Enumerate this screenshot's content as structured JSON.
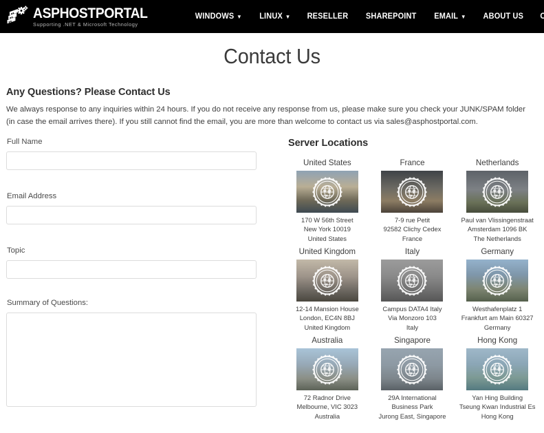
{
  "header": {
    "logo": {
      "icon": "server-rack-gear-icon",
      "title": "ASPHOSTPORTAL",
      "tagline": "Supporting .NET & Microsoft Technology"
    },
    "nav_items": [
      {
        "label": "WINDOWS",
        "has_caret": true
      },
      {
        "label": "LINUX",
        "has_caret": true
      },
      {
        "label": "RESELLER",
        "has_caret": false
      },
      {
        "label": "SHAREPOINT",
        "has_caret": false
      },
      {
        "label": "EMAIL",
        "has_caret": true
      },
      {
        "label": "ABOUT US",
        "has_caret": false
      },
      {
        "label": "CONTACT",
        "has_caret": false
      }
    ],
    "background_color": "#000000",
    "text_color": "#ffffff"
  },
  "page": {
    "title": "Contact Us"
  },
  "intro": {
    "heading": "Any Questions? Please Contact Us",
    "paragraph": "We always response to any inquiries within 24 hours. If you do not receive any response from us, please make sure you check your JUNK/SPAM folder (in case the email arrives there). If you still cannot find the email, you are more than welcome to contact us via sales@asphostportal.com."
  },
  "form": {
    "fields": [
      {
        "label": "Full Name",
        "value": "",
        "placeholder": "",
        "type": "text"
      },
      {
        "label": "Email Address",
        "value": "",
        "placeholder": "",
        "type": "text"
      },
      {
        "label": "Topic",
        "value": "",
        "placeholder": "",
        "type": "text"
      },
      {
        "label": "Summary of Questions:",
        "value": "",
        "placeholder": "",
        "type": "textarea"
      }
    ]
  },
  "server_locations": {
    "heading": "Server Locations",
    "items": [
      {
        "country": "United States",
        "image": "washington-dc-capitol-photo",
        "seal": "asphostportal-globe-seal",
        "address": [
          "170 W 56th Street",
          "New York 10019",
          "United States"
        ]
      },
      {
        "country": "France",
        "image": "paris-eiffel-tower-photo",
        "seal": "asphostportal-globe-seal",
        "address": [
          "7-9 rue Petit",
          "92582 Clichy Cedex",
          "France"
        ]
      },
      {
        "country": "Netherlands",
        "image": "dutch-windmill-photo",
        "seal": "asphostportal-globe-seal",
        "address": [
          "Paul van Vlissingenstraat",
          "Amsterdam 1096 BK",
          "The Netherlands"
        ]
      },
      {
        "country": "United Kingdom",
        "image": "london-big-ben-photo",
        "seal": "asphostportal-globe-seal",
        "address": [
          "12-14 Mansion House",
          "London, EC4N 8BJ",
          "United Kingdom"
        ]
      },
      {
        "country": "Italy",
        "image": "milan-duomo-cathedral-photo",
        "seal": "asphostportal-globe-seal",
        "address": [
          "Campus DATA4 Italy",
          "Via Monzoro 103",
          "Italy"
        ]
      },
      {
        "country": "Germany",
        "image": "frankfurt-skyline-photo",
        "seal": "asphostportal-globe-seal",
        "address": [
          "Westhafenplatz 1",
          "Frankfurt am Main 60327",
          "Germany"
        ]
      },
      {
        "country": "Australia",
        "image": "melbourne-skyline-photo",
        "seal": "asphostportal-globe-seal",
        "address": [
          "72 Radnor Drive",
          "Melbourne, VIC 3023",
          "Australia"
        ]
      },
      {
        "country": "Singapore",
        "image": "singapore-merlion-photo",
        "seal": "asphostportal-globe-seal",
        "address": [
          "29A International",
          "Business Park",
          "Jurong East, Singapore"
        ]
      },
      {
        "country": "Hong Kong",
        "image": "hong-kong-harbour-photo",
        "seal": "asphostportal-globe-seal",
        "address": [
          "Yan Hing Building",
          "Tseung Kwan Industrial Es",
          "Hong Kong"
        ]
      }
    ]
  }
}
